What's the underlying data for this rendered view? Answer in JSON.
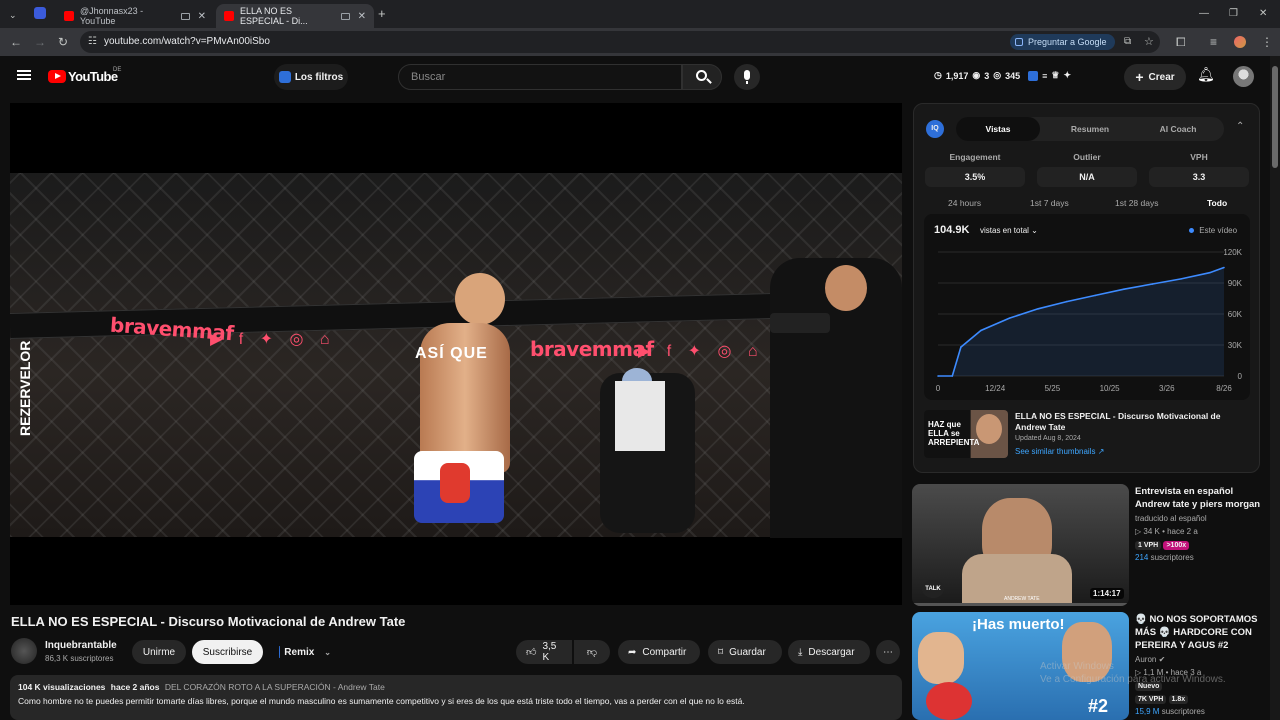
{
  "browser": {
    "tabs": [
      {
        "label": "@Jhonnasx23 - YouTube"
      },
      {
        "label": "ELLA NO ES ESPECIAL - Di..."
      }
    ],
    "url": "youtube.com/watch?v=PMvAn00iSbo",
    "ask_google": "Preguntar a Google",
    "new_tab": "+"
  },
  "header": {
    "logo": "YouTube",
    "region": "DE",
    "filters_label": "Los filtros",
    "search_placeholder": "Buscar",
    "stats": {
      "a": "1,917",
      "b": "3",
      "c": "345"
    },
    "create_label": "Crear",
    "icons": [
      "menu-icon",
      "search-icon",
      "mic-icon",
      "bell-icon",
      "avatar"
    ]
  },
  "video": {
    "subtitle": "ASÍ QUE",
    "brand_text": "bravemmaf",
    "side_text": "REZERVELOR",
    "title": "ELLA NO ES ESPECIAL - Discurso Motivacional de Andrew Tate"
  },
  "channel": {
    "name": "Inquebrantable",
    "subscribers": "86,3 K suscriptores",
    "join": "Unirme",
    "subscribe": "Suscribirse",
    "remix": "Remix"
  },
  "actions": {
    "likes": "3,5 K",
    "share": "Compartir",
    "save": "Guardar",
    "download": "Descargar"
  },
  "description": {
    "views": "104 K visualizaciones",
    "age": "hace 2 años",
    "tags": "DEL CORAZÓN ROTO A LA SUPERACIÓN - Andrew Tate",
    "text": "Como hombre no te puedes permitir tomarte días libres, porque el mundo masculino es sumamente competitivo y si eres de los que está triste todo el tiempo, vas a perder con el que no lo está."
  },
  "panel": {
    "logo": "IQ",
    "tabs": [
      "Vistas",
      "Resumen",
      "AI Coach"
    ],
    "active_tab": "Vistas",
    "metrics": [
      {
        "label": "Engagement",
        "value": "3.5%"
      },
      {
        "label": "Outlier",
        "value": "N/A"
      },
      {
        "label": "VPH",
        "value": "3.3"
      }
    ],
    "ranges": [
      "24 hours",
      "1st 7 days",
      "1st 28 days",
      "Todo"
    ],
    "active_range": "Todo",
    "total_views": "104.9K",
    "views_selector": "vistas en total",
    "legend": "Este vídeo",
    "thumb_title": "ELLA NO ES ESPECIAL - Discurso Motivacional de Andrew Tate",
    "updated": "Updated Aug 8, 2024",
    "similar": "See similar thumbnails ↗",
    "thumb_text": "HAZ que ELLA se ARREPIENTA"
  },
  "chart_data": {
    "type": "area",
    "x": [
      "0",
      "12/24",
      "5/25",
      "10/25",
      "3/26",
      "8/26"
    ],
    "y_ticks": [
      "0",
      "30K",
      "60K",
      "90K",
      "120K"
    ],
    "ylim": [
      0,
      120000
    ],
    "series": [
      {
        "name": "Este vídeo",
        "points": [
          [
            0,
            0
          ],
          [
            0.05,
            0
          ],
          [
            0.08,
            28000
          ],
          [
            0.15,
            44000
          ],
          [
            0.25,
            56000
          ],
          [
            0.35,
            65000
          ],
          [
            0.45,
            72000
          ],
          [
            0.55,
            78000
          ],
          [
            0.65,
            84000
          ],
          [
            0.75,
            89000
          ],
          [
            0.85,
            94000
          ],
          [
            0.95,
            100000
          ],
          [
            1.0,
            105000
          ]
        ]
      }
    ],
    "color": "#3d8bff"
  },
  "recommendations": [
    {
      "title": "Entrevista en español Andrew tate y piers morgan",
      "subtitle": "traducido al español",
      "views": "34 K",
      "age": "hace 2 a",
      "vph": "1 VPH",
      "outlier": ">100x",
      "subs": "214",
      "subs_label": "suscriptores",
      "duration": "1:14:17",
      "thumb_badge": "TALK",
      "thumb_caption": "ANDREW TATE"
    },
    {
      "title": "💀 NO NOS SOPORTAMOS MÁS 💀 HARDCORE CON PEREIRA Y AGUS #2",
      "channel": "Auron",
      "views": "1,1 M",
      "age": "hace 3 a",
      "new_label": "Nuevo",
      "vph": "7K VPH",
      "outlier": "1.8x",
      "subs": "15,9 M",
      "subs_label": "suscriptores",
      "thumb_text": "¡Has muerto!",
      "thumb_tag": "#2"
    }
  ],
  "os_watermark": {
    "line1": "Activar Windows",
    "line2": "Ve a Configuración para activar Windows."
  }
}
